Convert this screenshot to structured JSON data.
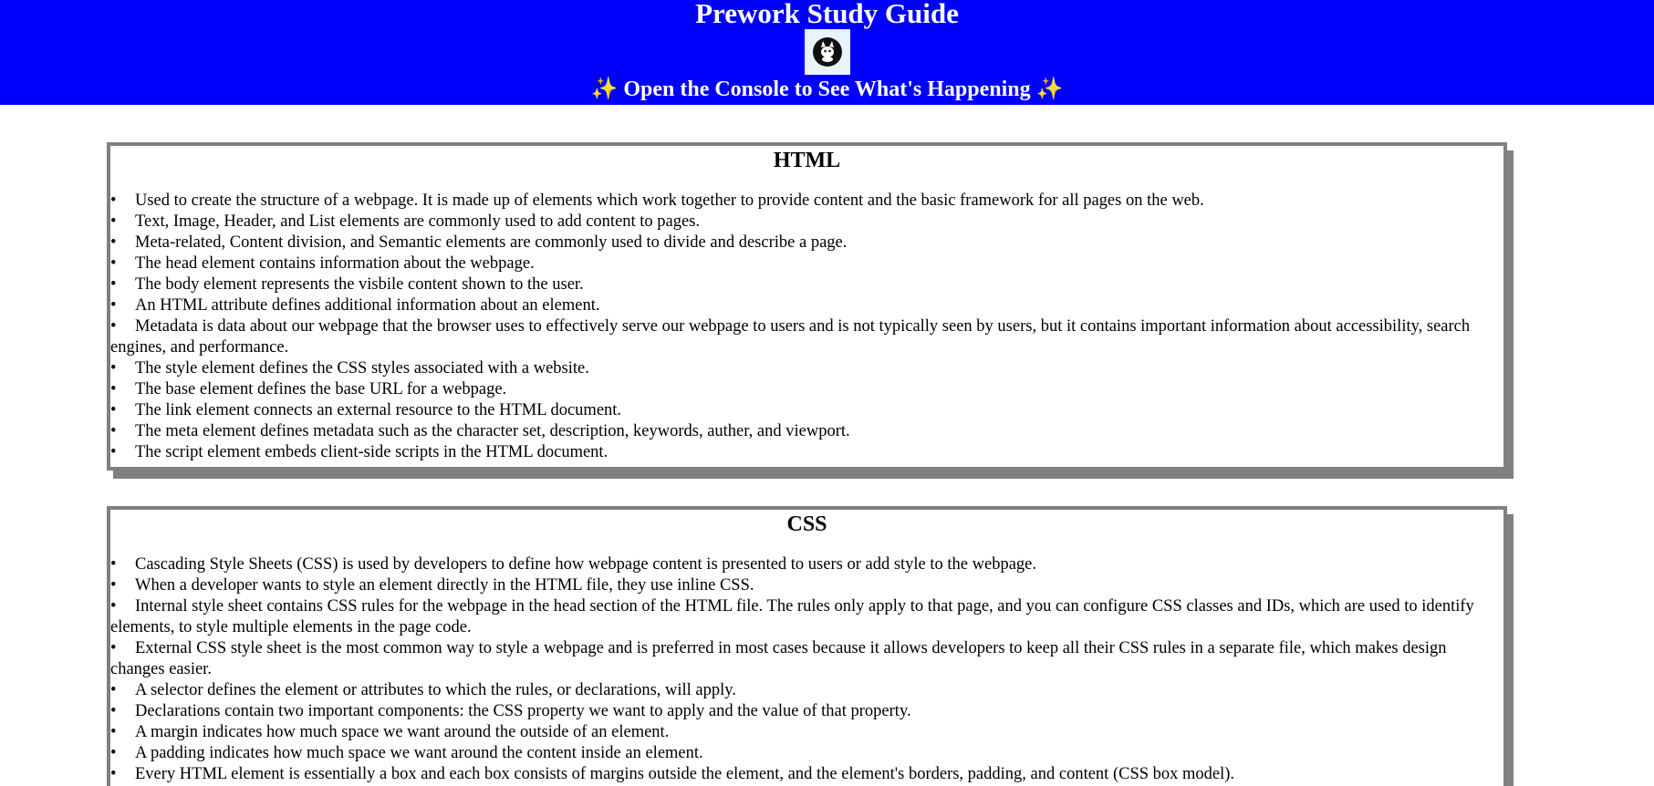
{
  "header": {
    "title": "Prework Study Guide",
    "logo_icon": "cat-logo-icon",
    "subtitle_prefix": "✨",
    "subtitle": "Open the Console to See What's Happening",
    "subtitle_suffix": "✨",
    "background_color": "#0000ff",
    "text_color": "#ffffff"
  },
  "sections": {
    "html": {
      "heading": "HTML",
      "items": [
        "Used to create the structure of a webpage. It is made up of elements which work together to provide content and the basic framework for all pages on the web.",
        "Text, Image, Header, and List elements are commonly used to add content to pages.",
        "Meta-related, Content division, and Semantic elements are commonly used to divide and describe a page.",
        "The head element contains information about the webpage.",
        "The body element represents the visbile content shown to the user.",
        "An HTML attribute defines additional information about an element.",
        "Metadata is data about our webpage that the browser uses to effectively serve our webpage to users and is not typically seen by users, but it contains important information about accessibility, search engines, and performance.",
        "The style element defines the CSS styles associated with a website.",
        "The base element defines the base URL for a webpage.",
        "The link element connects an external resource to the HTML document.",
        "The meta element defines metadata such as the character set, description, keywords, auther, and viewport.",
        "The script element embeds client-side scripts in the HTML document."
      ]
    },
    "css": {
      "heading": "CSS",
      "items": [
        "Cascading Style Sheets (CSS) is used by developers to define how webpage content is presented to users or add style to the webpage.",
        "When a developer wants to style an element directly in the HTML file, they use inline CSS.",
        "Internal style sheet contains CSS rules for the webpage in the head section of the HTML file. The rules only apply to that page, and you can configure CSS classes and IDs, which are used to identify elements, to style multiple elements in the page code.",
        "External CSS style sheet is the most common way to style a webpage and is preferred in most cases because it allows developers to keep all their CSS rules in a separate file, which makes design changes easier.",
        "A selector defines the element or attributes to which the rules, or declarations, will apply.",
        "Declarations contain two important components: the CSS property we want to apply and the value of that property.",
        "A margin indicates how much space we want around the outside of an element.",
        "A padding indicates how much space we want around the content inside an element.",
        "Every HTML element is essentially a box and each box consists of margins outside the element, and the element's borders, padding, and content (CSS box model)."
      ]
    }
  },
  "colors": {
    "card_border": "#808080",
    "page_background": "#ffffff"
  }
}
